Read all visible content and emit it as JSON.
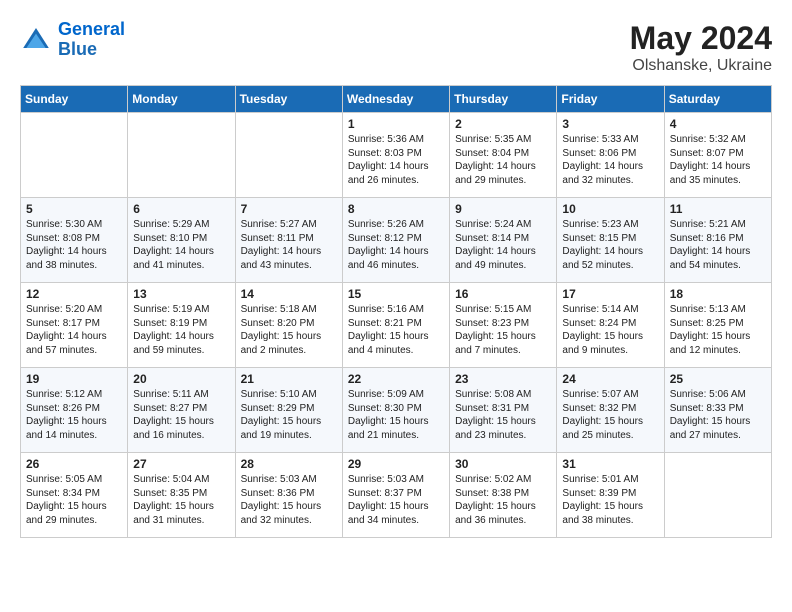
{
  "header": {
    "logo_line1": "General",
    "logo_line2": "Blue",
    "month_year": "May 2024",
    "location": "Olshanske, Ukraine"
  },
  "weekdays": [
    "Sunday",
    "Monday",
    "Tuesday",
    "Wednesday",
    "Thursday",
    "Friday",
    "Saturday"
  ],
  "weeks": [
    [
      {
        "day": "",
        "info": ""
      },
      {
        "day": "",
        "info": ""
      },
      {
        "day": "",
        "info": ""
      },
      {
        "day": "1",
        "info": "Sunrise: 5:36 AM\nSunset: 8:03 PM\nDaylight: 14 hours\nand 26 minutes."
      },
      {
        "day": "2",
        "info": "Sunrise: 5:35 AM\nSunset: 8:04 PM\nDaylight: 14 hours\nand 29 minutes."
      },
      {
        "day": "3",
        "info": "Sunrise: 5:33 AM\nSunset: 8:06 PM\nDaylight: 14 hours\nand 32 minutes."
      },
      {
        "day": "4",
        "info": "Sunrise: 5:32 AM\nSunset: 8:07 PM\nDaylight: 14 hours\nand 35 minutes."
      }
    ],
    [
      {
        "day": "5",
        "info": "Sunrise: 5:30 AM\nSunset: 8:08 PM\nDaylight: 14 hours\nand 38 minutes."
      },
      {
        "day": "6",
        "info": "Sunrise: 5:29 AM\nSunset: 8:10 PM\nDaylight: 14 hours\nand 41 minutes."
      },
      {
        "day": "7",
        "info": "Sunrise: 5:27 AM\nSunset: 8:11 PM\nDaylight: 14 hours\nand 43 minutes."
      },
      {
        "day": "8",
        "info": "Sunrise: 5:26 AM\nSunset: 8:12 PM\nDaylight: 14 hours\nand 46 minutes."
      },
      {
        "day": "9",
        "info": "Sunrise: 5:24 AM\nSunset: 8:14 PM\nDaylight: 14 hours\nand 49 minutes."
      },
      {
        "day": "10",
        "info": "Sunrise: 5:23 AM\nSunset: 8:15 PM\nDaylight: 14 hours\nand 52 minutes."
      },
      {
        "day": "11",
        "info": "Sunrise: 5:21 AM\nSunset: 8:16 PM\nDaylight: 14 hours\nand 54 minutes."
      }
    ],
    [
      {
        "day": "12",
        "info": "Sunrise: 5:20 AM\nSunset: 8:17 PM\nDaylight: 14 hours\nand 57 minutes."
      },
      {
        "day": "13",
        "info": "Sunrise: 5:19 AM\nSunset: 8:19 PM\nDaylight: 14 hours\nand 59 minutes."
      },
      {
        "day": "14",
        "info": "Sunrise: 5:18 AM\nSunset: 8:20 PM\nDaylight: 15 hours\nand 2 minutes."
      },
      {
        "day": "15",
        "info": "Sunrise: 5:16 AM\nSunset: 8:21 PM\nDaylight: 15 hours\nand 4 minutes."
      },
      {
        "day": "16",
        "info": "Sunrise: 5:15 AM\nSunset: 8:23 PM\nDaylight: 15 hours\nand 7 minutes."
      },
      {
        "day": "17",
        "info": "Sunrise: 5:14 AM\nSunset: 8:24 PM\nDaylight: 15 hours\nand 9 minutes."
      },
      {
        "day": "18",
        "info": "Sunrise: 5:13 AM\nSunset: 8:25 PM\nDaylight: 15 hours\nand 12 minutes."
      }
    ],
    [
      {
        "day": "19",
        "info": "Sunrise: 5:12 AM\nSunset: 8:26 PM\nDaylight: 15 hours\nand 14 minutes."
      },
      {
        "day": "20",
        "info": "Sunrise: 5:11 AM\nSunset: 8:27 PM\nDaylight: 15 hours\nand 16 minutes."
      },
      {
        "day": "21",
        "info": "Sunrise: 5:10 AM\nSunset: 8:29 PM\nDaylight: 15 hours\nand 19 minutes."
      },
      {
        "day": "22",
        "info": "Sunrise: 5:09 AM\nSunset: 8:30 PM\nDaylight: 15 hours\nand 21 minutes."
      },
      {
        "day": "23",
        "info": "Sunrise: 5:08 AM\nSunset: 8:31 PM\nDaylight: 15 hours\nand 23 minutes."
      },
      {
        "day": "24",
        "info": "Sunrise: 5:07 AM\nSunset: 8:32 PM\nDaylight: 15 hours\nand 25 minutes."
      },
      {
        "day": "25",
        "info": "Sunrise: 5:06 AM\nSunset: 8:33 PM\nDaylight: 15 hours\nand 27 minutes."
      }
    ],
    [
      {
        "day": "26",
        "info": "Sunrise: 5:05 AM\nSunset: 8:34 PM\nDaylight: 15 hours\nand 29 minutes."
      },
      {
        "day": "27",
        "info": "Sunrise: 5:04 AM\nSunset: 8:35 PM\nDaylight: 15 hours\nand 31 minutes."
      },
      {
        "day": "28",
        "info": "Sunrise: 5:03 AM\nSunset: 8:36 PM\nDaylight: 15 hours\nand 32 minutes."
      },
      {
        "day": "29",
        "info": "Sunrise: 5:03 AM\nSunset: 8:37 PM\nDaylight: 15 hours\nand 34 minutes."
      },
      {
        "day": "30",
        "info": "Sunrise: 5:02 AM\nSunset: 8:38 PM\nDaylight: 15 hours\nand 36 minutes."
      },
      {
        "day": "31",
        "info": "Sunrise: 5:01 AM\nSunset: 8:39 PM\nDaylight: 15 hours\nand 38 minutes."
      },
      {
        "day": "",
        "info": ""
      }
    ]
  ]
}
